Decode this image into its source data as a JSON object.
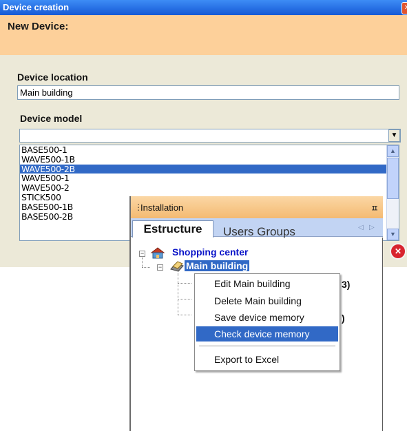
{
  "window": {
    "title": "Device creation",
    "close_glyph": "✕",
    "banner": "New Device:",
    "location_label": "Device location",
    "location_value": "Main building",
    "model_label": "Device model",
    "model_value": "",
    "dropdown_glyph": "▼",
    "models": [
      "BASE500-1",
      "WAVE500-1B",
      "WAVE500-2B",
      "WAVE500-1",
      "WAVE500-2",
      "STICK500",
      "BASE500-1B",
      "BASE500-2B"
    ],
    "selected_model": "WAVE500-2B"
  },
  "panel": {
    "title": "Installation",
    "pin_glyph": "ㅍ",
    "tabs": [
      "Estructure",
      "Users Groups"
    ],
    "tab_prev": "◁",
    "tab_next": "▷",
    "tree": {
      "root": "Shopping center",
      "child": "Main building",
      "partial_1": "3)",
      "partial_2": ")"
    }
  },
  "context_menu": {
    "items": [
      "Edit Main building",
      "Delete Main building",
      "Save device memory",
      "Check device memory",
      "Export to Excel"
    ],
    "highlighted": "Check device memory"
  },
  "colors": {
    "title_bar": "#2a6fe6",
    "banner": "#fdd09a",
    "selection": "#3169c6",
    "tree_root_text": "#0a14c8",
    "close_round": "#d8242f"
  }
}
